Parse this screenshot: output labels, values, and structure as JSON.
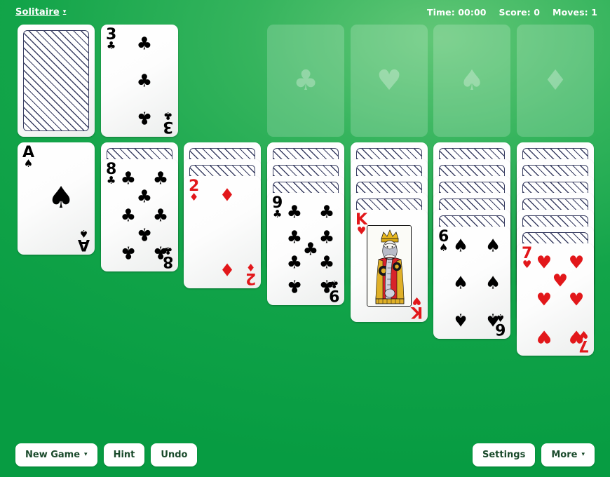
{
  "header": {
    "brand": "Solitaire",
    "brand_caret": "▾",
    "time": "Time: 00:00",
    "score": "Score: 0",
    "moves": "Moves: 1"
  },
  "footer": {
    "new_game": "New Game",
    "new_game_caret": "▾",
    "hint": "Hint",
    "undo": "Undo",
    "settings": "Settings",
    "more": "More",
    "more_caret": "▾"
  },
  "colors": {
    "felt_light": "#62c777",
    "felt_dark": "#079c42",
    "card_white": "#ffffff",
    "red_suit": "#e2171a",
    "black_suit": "#000000",
    "card_back_ink": "#3a3f63"
  },
  "stock": {
    "label": "stock-pile",
    "face_down": true
  },
  "waste": {
    "label": "waste-pile",
    "card": {
      "rank": "3",
      "suit": "clubs",
      "symbol": "♣",
      "color": "black",
      "pip_count": 3
    }
  },
  "foundations": [
    {
      "suit": "clubs",
      "symbol": "♣",
      "empty": true
    },
    {
      "suit": "hearts",
      "symbol": "♥",
      "empty": true
    },
    {
      "suit": "spades",
      "symbol": "♠",
      "empty": true
    },
    {
      "suit": "diamonds",
      "symbol": "♦",
      "empty": true
    }
  ],
  "tableau": [
    {
      "column": 1,
      "face_down": 0,
      "face_up": [
        {
          "rank": "A",
          "suit": "spades",
          "symbol": "♠",
          "color": "black",
          "pip_count": 1
        }
      ]
    },
    {
      "column": 2,
      "face_down": 1,
      "face_up": [
        {
          "rank": "8",
          "suit": "clubs",
          "symbol": "♣",
          "color": "black",
          "pip_count": 8
        }
      ]
    },
    {
      "column": 3,
      "face_down": 2,
      "face_up": [
        {
          "rank": "2",
          "suit": "diamonds",
          "symbol": "♦",
          "color": "red",
          "pip_count": 2
        }
      ]
    },
    {
      "column": 4,
      "face_down": 3,
      "face_up": [
        {
          "rank": "9",
          "suit": "clubs",
          "symbol": "♣",
          "color": "black",
          "pip_count": 9
        }
      ]
    },
    {
      "column": 5,
      "face_down": 4,
      "face_up": [
        {
          "rank": "K",
          "suit": "hearts",
          "symbol": "♥",
          "color": "red",
          "court": true
        }
      ]
    },
    {
      "column": 6,
      "face_down": 5,
      "face_up": [
        {
          "rank": "6",
          "suit": "spades",
          "symbol": "♠",
          "color": "black",
          "pip_count": 6
        }
      ]
    },
    {
      "column": 7,
      "face_down": 6,
      "face_up": [
        {
          "rank": "7",
          "suit": "hearts",
          "symbol": "♥",
          "color": "red",
          "pip_count": 7
        }
      ]
    }
  ]
}
